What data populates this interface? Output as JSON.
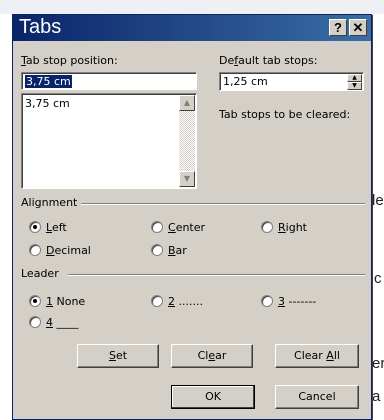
{
  "window": {
    "title": "Tabs",
    "help_label": "?",
    "close_label": "✕"
  },
  "tab_stop_position": {
    "label_prefix": "",
    "label_key": "T",
    "label_rest": "ab stop position:",
    "value": "3,75 cm",
    "list_items": [
      "3,75 cm"
    ]
  },
  "default_tab_stops": {
    "label_prefix": "De",
    "label_key": "f",
    "label_rest": "ault tab stops:",
    "value": "1,25 cm"
  },
  "tab_stops_cleared_label": "Tab stops to be cleared:",
  "alignment": {
    "group_label": "Alignment",
    "options": [
      {
        "key": "L",
        "rest": "eft",
        "selected": true
      },
      {
        "key": "C",
        "rest": "enter",
        "selected": false
      },
      {
        "key": "R",
        "rest": "ight",
        "selected": false
      },
      {
        "key": "D",
        "rest": "ecimal",
        "selected": false
      },
      {
        "key": "B",
        "rest": "ar",
        "selected": false
      }
    ]
  },
  "leader": {
    "group_label": "Leader",
    "options": [
      {
        "key": "1",
        "rest": " None",
        "selected": true
      },
      {
        "key": "2",
        "rest": " .......",
        "selected": false
      },
      {
        "key": "3",
        "rest": " -------",
        "selected": false
      },
      {
        "key": "4",
        "rest": " ____",
        "selected": false
      }
    ]
  },
  "buttons": {
    "set": {
      "key": "S",
      "rest": "et"
    },
    "clear": {
      "prefix": "Cl",
      "key": "e",
      "rest": "ar"
    },
    "clear_all": {
      "prefix": "Clear ",
      "key": "A",
      "rest": "ll"
    },
    "ok": "OK",
    "cancel": "Cancel"
  },
  "background_chars": [
    "le",
    "c",
    "er",
    "a"
  ]
}
